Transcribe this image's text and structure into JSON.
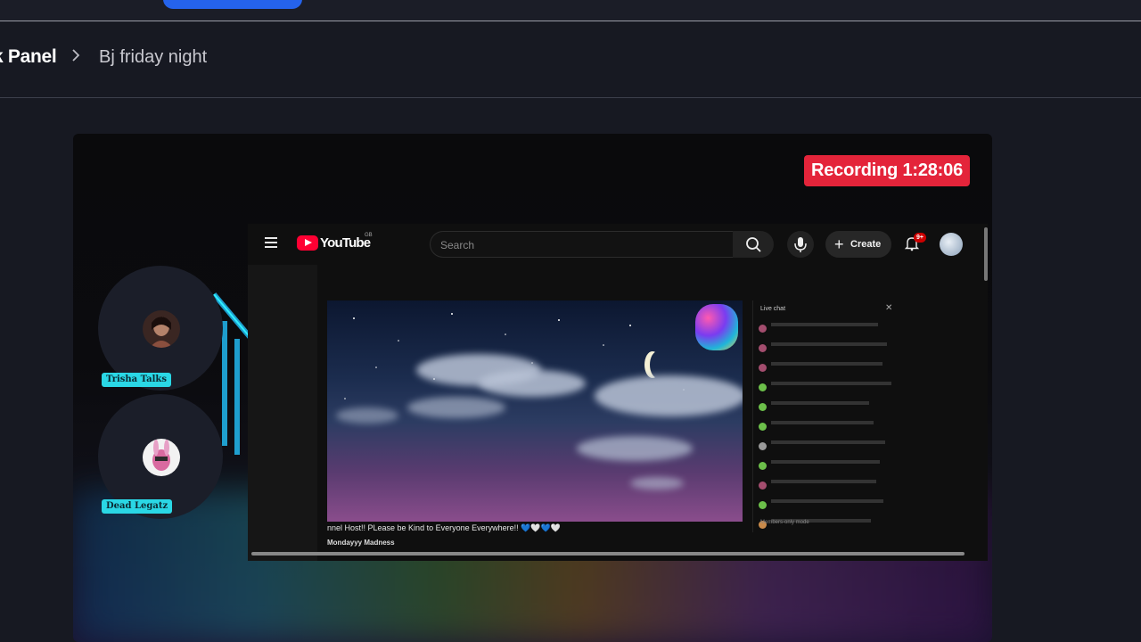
{
  "breadcrumb": {
    "root": "k Panel",
    "current": "Bj friday night"
  },
  "recording": {
    "label": "Recording 1:28:06"
  },
  "cams": [
    {
      "label": "Trisha Talks"
    },
    {
      "label": "Dead Legatz"
    }
  ],
  "youtube": {
    "brand": "YouTube",
    "country_code": "GB",
    "search_placeholder": "Search",
    "create_label": "Create",
    "notification_count": "9+",
    "ticker": "nnel Host!! PLease be Kind to Everyone Everywhere!! 💙🤍💙🤍",
    "video_title": "Mondayyy Madness",
    "chat_header": "Live chat",
    "chat_footer": "Members-only mode"
  },
  "colors": {
    "recording_bg": "#e4243a",
    "cam_label_bg": "#2ad7e5",
    "accent_blue": "#2563eb"
  }
}
